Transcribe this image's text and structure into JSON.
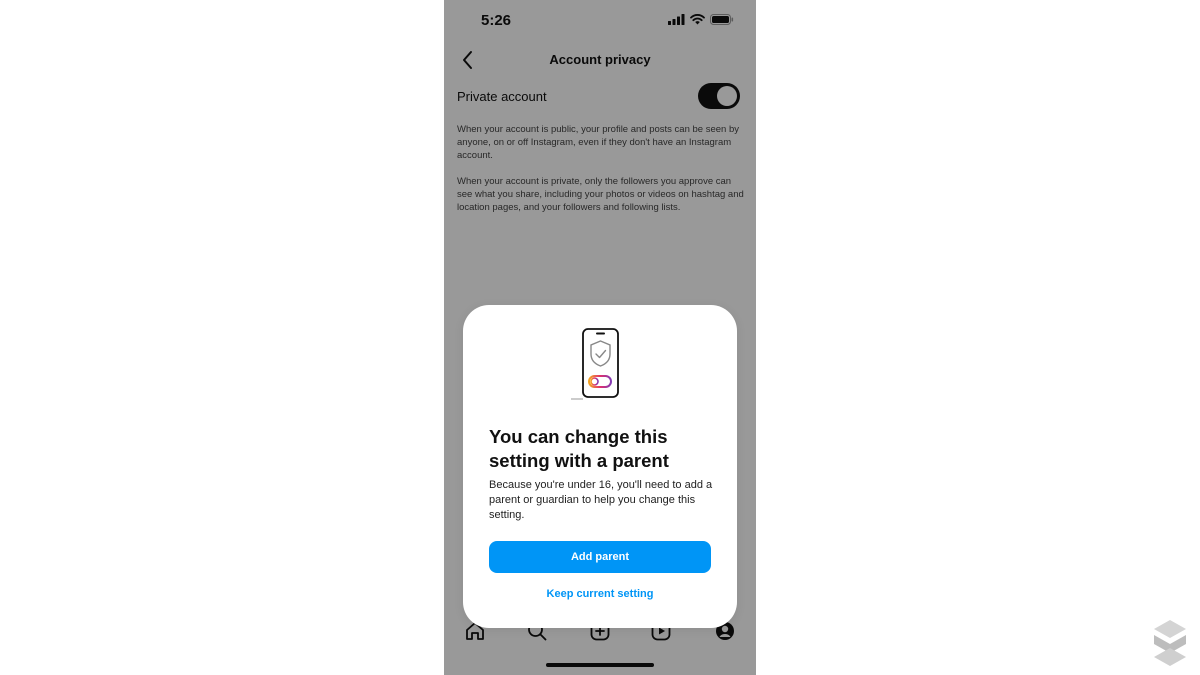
{
  "status_bar": {
    "time": "5:26"
  },
  "header": {
    "title": "Account privacy"
  },
  "setting": {
    "label": "Private account",
    "toggle_on": true
  },
  "descriptions": {
    "public": "When your account is public, your profile and posts can be seen by anyone, on or off Instagram, even if they don't have an Instagram account.",
    "private": "When your account is private, only the followers you approve can see what you share, including your photos or videos on hashtag and location pages, and your followers and following lists."
  },
  "dialog": {
    "title": "You can change this setting with a parent",
    "body": "Because you're under 16, you'll need to add a parent or guardian to help you change this setting.",
    "primary_button": "Add parent",
    "secondary_button": "Keep current setting"
  },
  "tab_bar": {
    "items": [
      "home-icon",
      "search-icon",
      "new-post-icon",
      "reels-icon",
      "profile-icon"
    ]
  },
  "colors": {
    "accent": "#0095f6",
    "toggle_on": "#111111",
    "scrim": "rgba(0,0,0,0.40)"
  }
}
